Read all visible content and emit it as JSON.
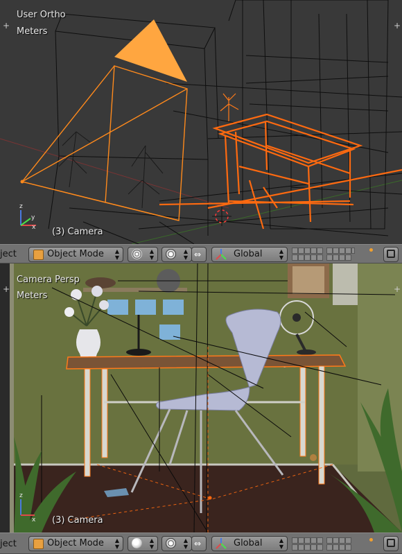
{
  "top_viewport": {
    "view_label": "User Ortho",
    "units_label": "Meters",
    "object_label": "(3) Camera"
  },
  "bottom_viewport": {
    "view_label": "Camera Persp",
    "units_label": "Meters",
    "object_label": "(3) Camera"
  },
  "top_header": {
    "clipped_menu": "ject",
    "mode": "Object Mode",
    "orientation": "Global"
  },
  "bottom_header": {
    "clipped_menu": "ject",
    "mode": "Object Mode",
    "orientation": "Global"
  },
  "colors": {
    "selection": "#ff7a1a",
    "camera_triangle": "#ffa640",
    "wire": "#101010",
    "wall": "#6b7442",
    "floor": "#3a241e",
    "header": "#727272"
  },
  "icons": [
    "cube-icon",
    "viewport-shading-icon",
    "pivot-icon",
    "manipulator-icon",
    "transform-orientation-icon",
    "layers-icon",
    "render-icon"
  ]
}
